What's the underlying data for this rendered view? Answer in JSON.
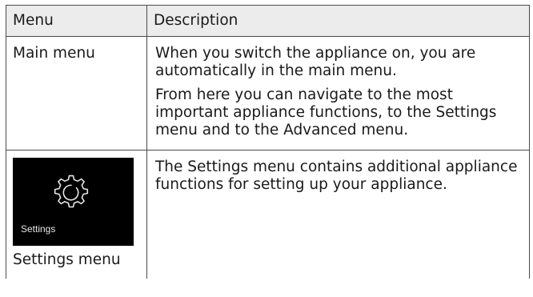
{
  "table": {
    "headers": {
      "menu": "Menu",
      "description": "Description"
    },
    "rows": [
      {
        "menu": "Main menu",
        "description": [
          "When you switch the appliance on, you are automatically in the main menu.",
          "From here you can navigate to the most important appliance functions, to the Settings menu and to the Advanced menu."
        ]
      },
      {
        "menu": "Settings menu",
        "screen_label": "Settings",
        "screen_icon": "gear-icon",
        "description": [
          "The Settings menu contains additional appliance functions for setting up your appliance."
        ]
      }
    ]
  },
  "colors": {
    "header_background": "#ececec",
    "border": "#4a4a4a",
    "screen_background": "#000000",
    "screen_foreground": "#e6e6e6"
  }
}
